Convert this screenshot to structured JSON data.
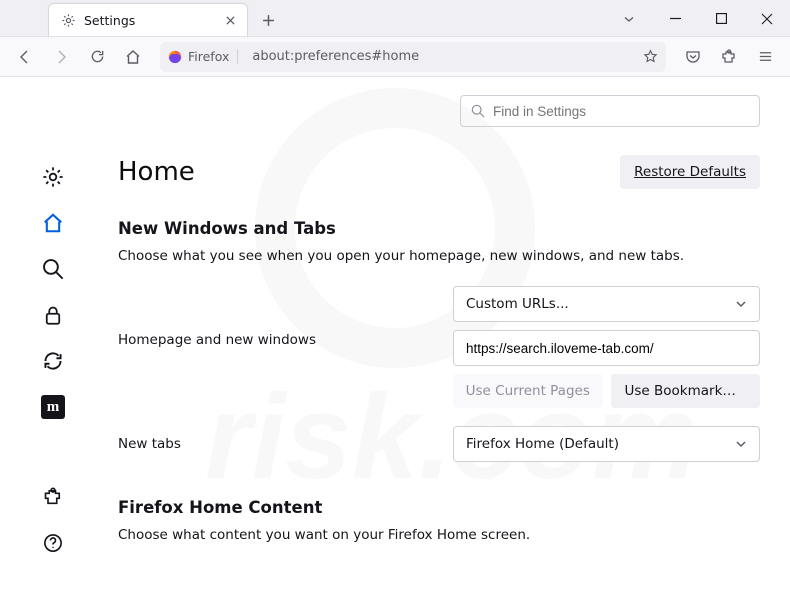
{
  "tab": {
    "title": "Settings"
  },
  "toolbar": {
    "identity_label": "Firefox",
    "url": "about:preferences#home"
  },
  "find": {
    "placeholder": "Find in Settings"
  },
  "page": {
    "title": "Home",
    "restore_defaults": "Restore Defaults",
    "section1_title": "New Windows and Tabs",
    "section1_desc": "Choose what you see when you open your homepage, new windows, and new tabs.",
    "homepage_label": "Homepage and new windows",
    "homepage_select": "Custom URLs...",
    "homepage_url_value": "https://search.iloveme-tab.com/",
    "use_current": "Use Current Pages",
    "use_bookmark": "Use Bookmark…",
    "newtabs_label": "New tabs",
    "newtabs_select": "Firefox Home (Default)",
    "section2_title": "Firefox Home Content",
    "section2_desc": "Choose what content you want on your Firefox Home screen."
  }
}
